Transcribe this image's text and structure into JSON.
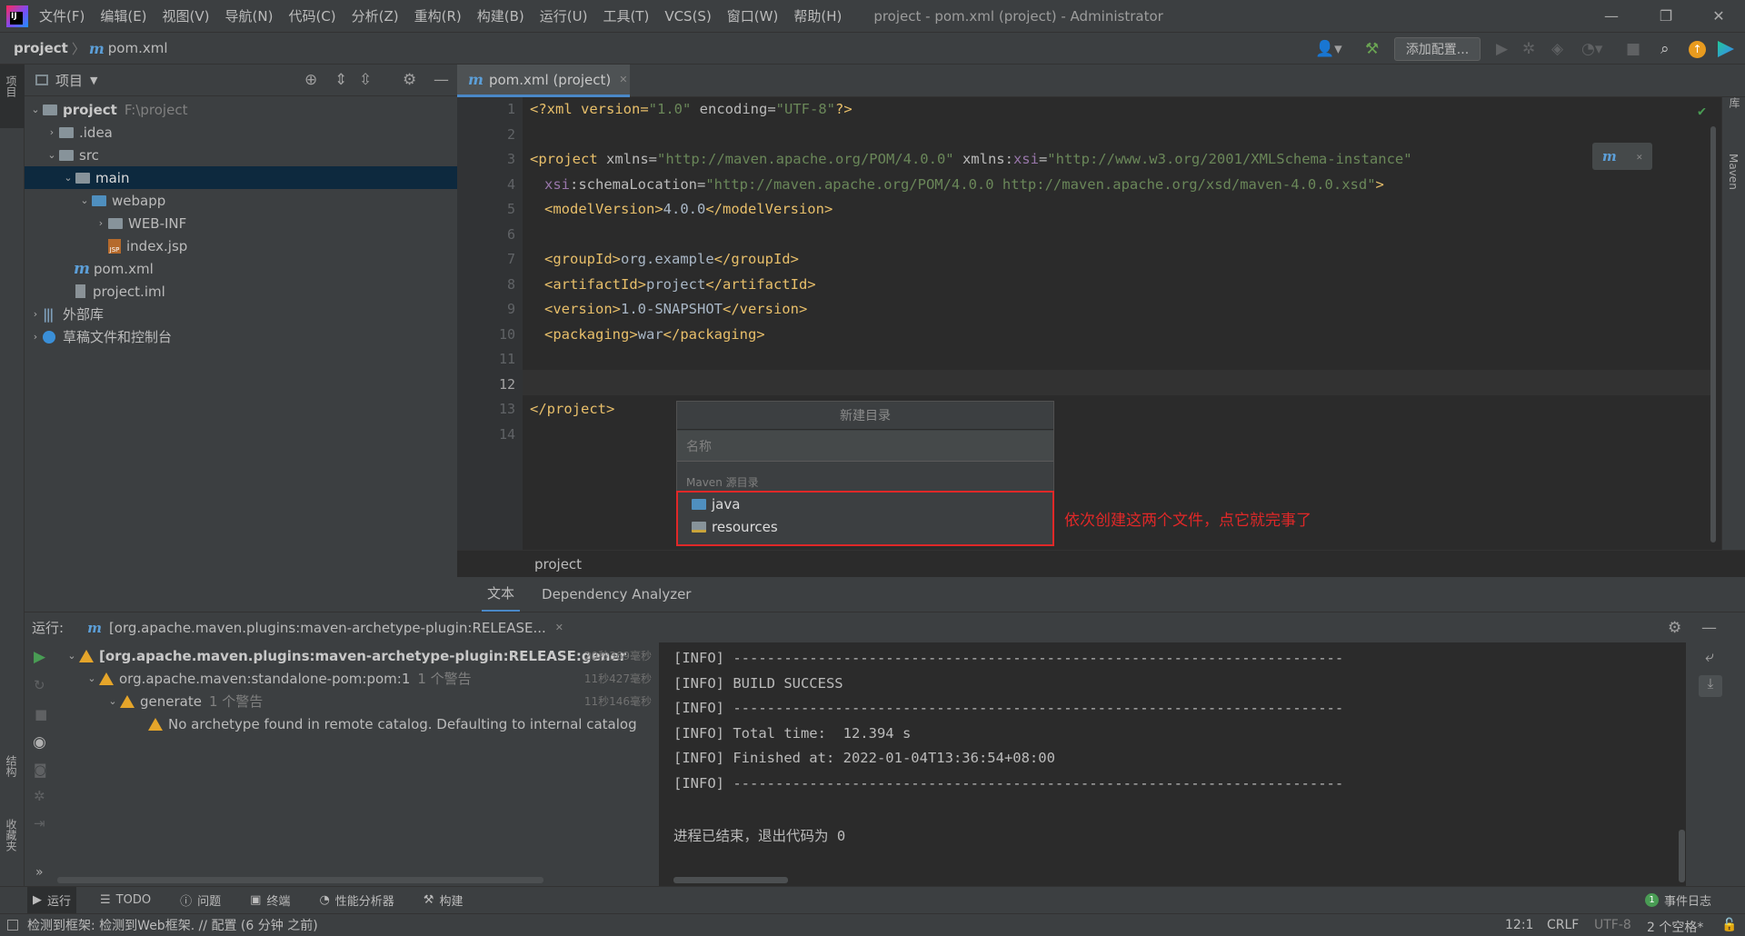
{
  "titlebar": {
    "menu": [
      "文件(F)",
      "编辑(E)",
      "视图(V)",
      "导航(N)",
      "代码(C)",
      "分析(Z)",
      "重构(R)",
      "构建(B)",
      "运行(U)",
      "工具(T)",
      "VCS(S)",
      "窗口(W)",
      "帮助(H)"
    ],
    "window_title": "project - pom.xml (project) - Administrator"
  },
  "navbar": {
    "project": "project",
    "separator": "〉",
    "file": "pom.xml",
    "add_config": "添加配置..."
  },
  "left_strip": {
    "project_tab": "项目",
    "structure_tab": "结构",
    "favorites_tab": "收藏夹"
  },
  "right_strip": {
    "database_tab": "数据库",
    "maven_tab": "Maven"
  },
  "project_panel": {
    "title": "项目",
    "tree": [
      {
        "label": "project",
        "hint": "F:\\project"
      },
      {
        "label": ".idea"
      },
      {
        "label": "src"
      },
      {
        "label": "main"
      },
      {
        "label": "webapp"
      },
      {
        "label": "WEB-INF"
      },
      {
        "label": "index.jsp"
      },
      {
        "label": "pom.xml"
      },
      {
        "label": "project.iml"
      },
      {
        "label": "外部库"
      },
      {
        "label": "草稿文件和控制台"
      }
    ]
  },
  "editor": {
    "tab_label": "pom.xml (project)",
    "line_numbers": [
      "1",
      "2",
      "3",
      "4",
      "5",
      "6",
      "7",
      "8",
      "9",
      "10",
      "11",
      "12",
      "13",
      "14"
    ],
    "code": {
      "l1_a": "<?xml version=",
      "l1_b": "\"1.0\"",
      "l1_c": " encoding=",
      "l1_d": "\"UTF-8\"",
      "l1_e": "?>",
      "l3_a": "<project ",
      "l3_b": "xmlns=",
      "l3_c": "\"http://maven.apache.org/POM/4.0.0\"",
      "l3_d": " xmlns:",
      "l3_e": "xsi",
      "l3_f": "=",
      "l3_g": "\"http://www.w3.org/2001/XMLSchema-instance\"",
      "l4_a": "xsi",
      "l4_b": ":schemaLocation=",
      "l4_c": "\"http://maven.apache.org/POM/4.0.0 http://maven.apache.org/xsd/maven-4.0.0.xsd\"",
      "l4_d": ">",
      "l5_a": "<modelVersion>",
      "l5_b": "4.0.0",
      "l5_c": "</modelVersion>",
      "l7_a": "<groupId>",
      "l7_b": "org.example",
      "l7_c": "</groupId>",
      "l8_a": "<artifactId>",
      "l8_b": "project",
      "l8_c": "</artifactId>",
      "l9_a": "<version>",
      "l9_b": "1.0-SNAPSHOT",
      "l9_c": "</version>",
      "l10_a": "<packaging>",
      "l10_b": "war",
      "l10_c": "</packaging>",
      "l13": "</project>"
    },
    "breadcrumb": "project",
    "bottom_tabs": [
      "文本",
      "Dependency Analyzer"
    ]
  },
  "popup": {
    "title": "新建目录",
    "placeholder": "名称",
    "section": "Maven 源目录",
    "items": [
      "java",
      "resources"
    ]
  },
  "annotation": "依次创建这两个文件，点它就完事了",
  "run_panel": {
    "label": "运行:",
    "tab": "[org.apache.maven.plugins:maven-archetype-plugin:RELEASE...",
    "tree": [
      {
        "text": "[org.apache.maven.plugins:maven-archetype-plugin:RELEASE:gener",
        "time": "20秒369毫秒"
      },
      {
        "text": "org.apache.maven:standalone-pom:pom:1",
        "note": "1 个警告",
        "time": "11秒427毫秒"
      },
      {
        "text": "generate",
        "note": "1 个警告",
        "time": "11秒146毫秒"
      },
      {
        "text": "No archetype found in remote catalog. Defaulting to internal catalog"
      }
    ],
    "console": [
      "[INFO] ------------------------------------------------------------------------",
      "[INFO] BUILD SUCCESS",
      "[INFO] ------------------------------------------------------------------------",
      "[INFO] Total time:  12.394 s",
      "[INFO] Finished at: 2022-01-04T13:36:54+08:00",
      "[INFO] ------------------------------------------------------------------------",
      "",
      "进程已结束，退出代码为 0"
    ]
  },
  "tool_windows": [
    "运行",
    "TODO",
    "问题",
    "终端",
    "性能分析器",
    "构建"
  ],
  "event_log": {
    "count": "1",
    "label": "事件日志"
  },
  "statusbar": {
    "message": "检测到框架: 检测到Web框架. // 配置 (6 分钟 之前)",
    "position": "12:1",
    "line_sep": "CRLF",
    "encoding": "UTF-8",
    "indent": "2 个空格*"
  },
  "colors": {
    "accent": "#4a88c7",
    "annotation": "#e02828",
    "warning": "#e5a52a",
    "success": "#499c54"
  }
}
